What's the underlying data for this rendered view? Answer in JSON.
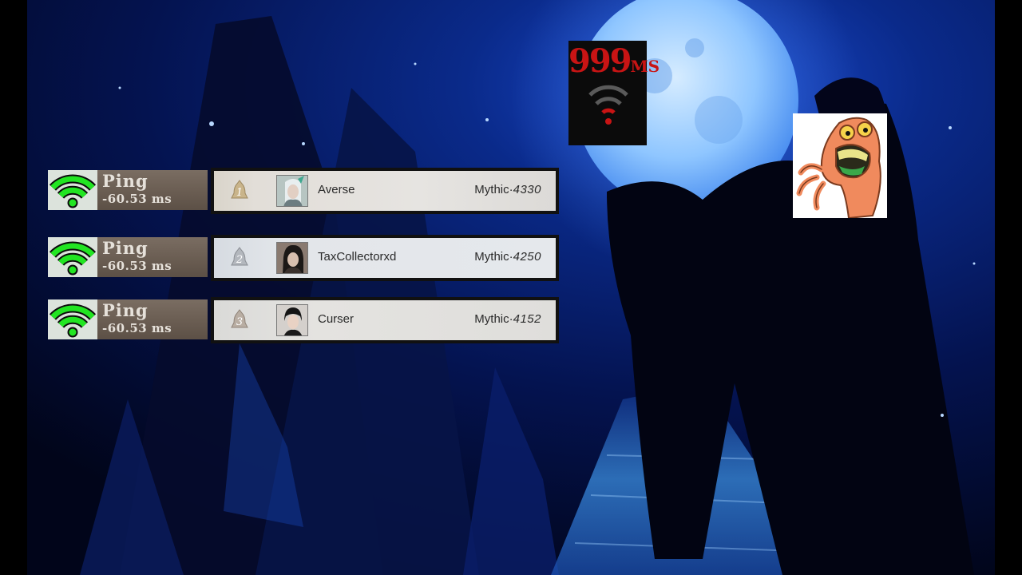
{
  "ping_panels": [
    {
      "title": "Ping",
      "value": "-60.53 ms"
    },
    {
      "title": "Ping",
      "value": "-60.53 ms"
    },
    {
      "title": "Ping",
      "value": "-60.53 ms"
    }
  ],
  "leaderboard": [
    {
      "rank": "1",
      "name": "Averse",
      "tier": "Mythic·",
      "score": "4330"
    },
    {
      "rank": "2",
      "name": "TaxCollectorxd",
      "tier": "Mythic·",
      "score": "4250"
    },
    {
      "rank": "3",
      "name": "Curser",
      "tier": "Mythic·",
      "score": "4152"
    }
  ],
  "latency_badge": {
    "number": "999",
    "unit": "MS"
  },
  "colors": {
    "wifi_green": "#22e522",
    "badge_red": "#c81414",
    "moon": "#7fb8ff",
    "background": "#040a2a"
  },
  "icons": {
    "ping": "wifi-signal-icon",
    "badge": "wifi-weak-icon",
    "rank": "bell-rank-icon",
    "meme": "screaming-creature-icon"
  }
}
